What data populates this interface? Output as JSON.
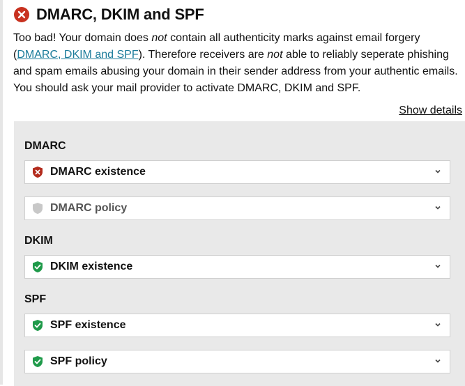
{
  "header": {
    "title": "DMARC, DKIM and SPF",
    "status_icon": "error-x-icon",
    "status_color": "#c8311f"
  },
  "description": {
    "part1": "Too bad! Your domain does ",
    "em1": "not",
    "part2": " contain all authenticity marks against email forgery (",
    "link": "DMARC, DKIM and SPF",
    "part3": "). Therefore receivers are ",
    "em2": "not",
    "part4": " able to reliably seperate phishing and spam emails abusing your domain in their sender address from your authentic emails. You should ask your mail provider to activate DMARC, DKIM and SPF."
  },
  "show_details": "Show details",
  "sections": {
    "dmarc": {
      "label": "DMARC",
      "checks": [
        {
          "label": "DMARC existence",
          "status": "fail",
          "icon": "shield-x-icon",
          "color": "#b32b1d"
        },
        {
          "label": "DMARC policy",
          "status": "neutral",
          "icon": "shield-icon",
          "color": "#c8c8c8"
        }
      ]
    },
    "dkim": {
      "label": "DKIM",
      "checks": [
        {
          "label": "DKIM existence",
          "status": "pass",
          "icon": "shield-check-icon",
          "color": "#1f9a4a"
        }
      ]
    },
    "spf": {
      "label": "SPF",
      "checks": [
        {
          "label": "SPF existence",
          "status": "pass",
          "icon": "shield-check-icon",
          "color": "#1f9a4a"
        },
        {
          "label": "SPF policy",
          "status": "pass",
          "icon": "shield-check-icon",
          "color": "#1f9a4a"
        }
      ]
    }
  }
}
